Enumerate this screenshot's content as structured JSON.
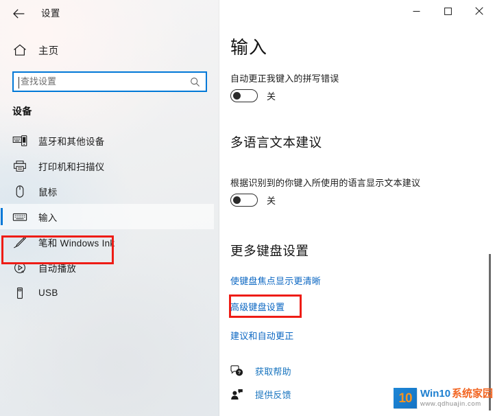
{
  "window": {
    "app_title": "设置",
    "back_icon": "back-arrow-icon",
    "controls": {
      "minimize_icon": "minimize-icon",
      "maximize_icon": "maximize-icon",
      "close_icon": "close-icon"
    }
  },
  "sidebar": {
    "home": {
      "label": "主页",
      "icon": "home-icon"
    },
    "search": {
      "placeholder": "查找设置",
      "value": "",
      "icon": "search-magnifier-icon"
    },
    "group_heading": "设备",
    "items": [
      {
        "label": "蓝牙和其他设备",
        "icon": "bluetooth-devices-icon",
        "selected": false
      },
      {
        "label": "打印机和扫描仪",
        "icon": "printer-icon",
        "selected": false
      },
      {
        "label": "鼠标",
        "icon": "mouse-icon",
        "selected": false
      },
      {
        "label": "输入",
        "icon": "keyboard-icon",
        "selected": true
      },
      {
        "label": "笔和 Windows Ink",
        "icon": "pen-icon",
        "selected": false
      },
      {
        "label": "自动播放",
        "icon": "autoplay-icon",
        "selected": false
      },
      {
        "label": "USB",
        "icon": "usb-icon",
        "selected": false
      }
    ]
  },
  "main": {
    "page_title": "输入",
    "settings": [
      {
        "description": "自动更正我键入的拼写错误",
        "toggle_state": "关",
        "toggle_on": false
      },
      {
        "heading": "多语言文本建议",
        "description": "根据识别到的你键入所使用的语言显示文本建议",
        "toggle_state": "关",
        "toggle_on": false
      }
    ],
    "more_settings": {
      "heading": "更多键盘设置",
      "links": [
        "使键盘焦点显示更清晰",
        "高级键盘设置",
        "建议和自动更正"
      ]
    },
    "footer_links": [
      {
        "label": "获取帮助",
        "icon": "help-bubble-icon"
      },
      {
        "label": "提供反馈",
        "icon": "feedback-person-icon"
      }
    ]
  },
  "watermark": {
    "tile_text": "10",
    "brand": "Win10",
    "brand_cn": "系统家园",
    "url": "www.qdhuajin.com"
  },
  "colors": {
    "accent": "#0078d7",
    "link": "#0a66c2",
    "annotation": "#ee1c15"
  }
}
